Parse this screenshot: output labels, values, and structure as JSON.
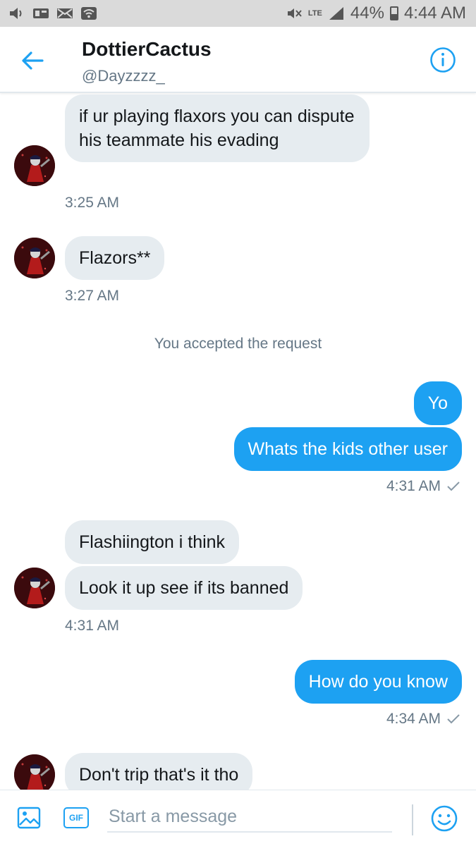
{
  "status_bar": {
    "lte_label": "LTE",
    "battery_percent": "44%",
    "time": "4:44 AM",
    "icons": [
      "volume-icon",
      "signal-icon",
      "mail-icon",
      "wifi-icon",
      "mute-icon",
      "cell-signal-icon",
      "battery-icon"
    ]
  },
  "header": {
    "name": "DottierCactus",
    "handle": "@Dayzzzz_",
    "back_icon": "arrow-left-icon",
    "info_icon": "info-icon",
    "accent": "#1da1f2"
  },
  "messages": [
    {
      "sender": "them",
      "text": "if ur playing flaxors you can dispute his teammate his evading"
    },
    {
      "sender": "them",
      "timestamp": "3:25 AM"
    },
    {
      "sender": "them",
      "text": "Flazors**"
    },
    {
      "sender": "them",
      "timestamp": "3:27 AM"
    },
    {
      "system": "You accepted the request"
    },
    {
      "sender": "me",
      "text": "Yo"
    },
    {
      "sender": "me",
      "text": "Whats the kids other user"
    },
    {
      "sender": "me",
      "timestamp": "4:31 AM"
    },
    {
      "sender": "them",
      "text": "Flashiington i think"
    },
    {
      "sender": "them",
      "text": "Look it up see if its banned"
    },
    {
      "sender": "them",
      "timestamp": "4:31 AM"
    },
    {
      "sender": "me",
      "text": "How do you know"
    },
    {
      "sender": "me",
      "timestamp": "4:34 AM"
    },
    {
      "sender": "them",
      "text": "Don't trip that's it tho"
    }
  ],
  "composer": {
    "placeholder": "Start a message",
    "gif_label": "GIF",
    "media_icon": "image-icon",
    "emoji_icon": "smiley-icon"
  },
  "colors": {
    "incoming_bubble": "#e6ecf0",
    "outgoing_bubble": "#1da1f2",
    "timestamp": "#657786"
  }
}
